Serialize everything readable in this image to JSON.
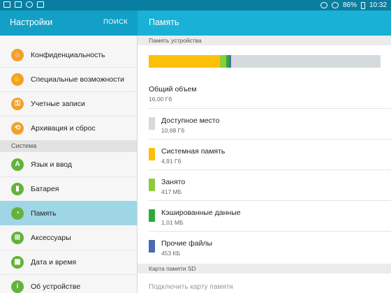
{
  "status_bar": {
    "battery": "86%",
    "time": "10:32",
    "icons": [
      "image-icon",
      "download-icon",
      "cloud-icon",
      "menu-icon",
      "alarm-icon",
      "no-disturb-icon",
      "battery-icon"
    ]
  },
  "left_header": {
    "title": "Настройки",
    "search_label": "ПОИСК"
  },
  "right_header": {
    "title": "Память"
  },
  "sidebar": {
    "items": [
      {
        "label": "Конфиденциальность",
        "icon": "privacy-icon"
      },
      {
        "label": "Специальные возможности",
        "icon": "accessibility-icon"
      },
      {
        "label": "Учетные записи",
        "icon": "key-icon"
      },
      {
        "label": "Архивация и сброс",
        "icon": "backup-icon"
      }
    ],
    "section_title": "Система",
    "system_items": [
      {
        "label": "Язык и ввод",
        "icon": "language-icon"
      },
      {
        "label": "Батарея",
        "icon": "battery-icon"
      },
      {
        "label": "Память",
        "icon": "storage-icon"
      },
      {
        "label": "Аксессуары",
        "icon": "accessories-icon"
      },
      {
        "label": "Дата и время",
        "icon": "calendar-icon"
      },
      {
        "label": "Об устройстве",
        "icon": "info-icon"
      }
    ]
  },
  "storage": {
    "device_section": "Память устройства",
    "total_label": "Общий объем",
    "total_value": "16,00 Гб",
    "usage_fractions": {
      "system": 0.307,
      "used": 0.026,
      "cached": 0.063,
      "misc": 0.028,
      "available": 0.668
    },
    "rows": [
      {
        "label": "Доступное место",
        "value": "10,68 Гб",
        "color": "#d5dadc"
      },
      {
        "label": "Системная память",
        "value": "4,91 Гб",
        "color": "#fcc00a"
      },
      {
        "label": "Занято",
        "value": "417 МБ",
        "color": "#8ccc3a"
      },
      {
        "label": "Кэшированные данные",
        "value": "1,01 МБ",
        "color": "#2eaa38"
      },
      {
        "label": "Прочие файлы",
        "value": "453 КБ",
        "color": "#4a6bb0"
      }
    ],
    "sd_section": "Карта памяти SD",
    "sd_connect": "Подключить карту памяти"
  }
}
